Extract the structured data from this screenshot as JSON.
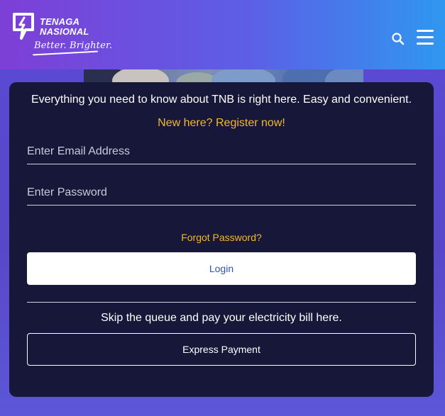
{
  "header": {
    "logo_line1": "TENAGA",
    "logo_line2": "NASIONAL",
    "tagline": "Better. Brighter.",
    "search_icon": "search-icon",
    "menu_icon": "hamburger-menu-icon"
  },
  "colors": {
    "header_gradient_start": "#7d3fd6",
    "header_gradient_end": "#2f97f0",
    "card_background": "#17173a",
    "accent_link": "#f5b72a",
    "login_text": "#2c57b5"
  },
  "login_card": {
    "intro": "Everything you need to know about TNB is right here. Easy and convenient.",
    "register_link": "New here? Register now!",
    "email_placeholder": "Enter Email Address",
    "password_placeholder": "Enter Password",
    "forgot_link": "Forgot Password?",
    "login_button": "Login",
    "skip_text": "Skip the queue and pay your electricity bill here.",
    "express_button": "Express Payment"
  }
}
